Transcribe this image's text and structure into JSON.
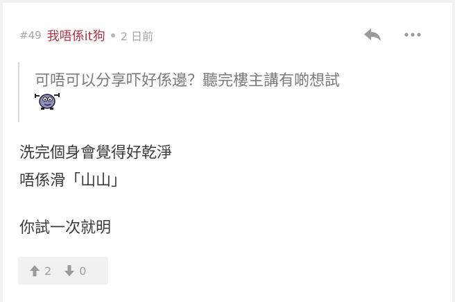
{
  "post": {
    "floor": "#49",
    "author": "我唔係it狗",
    "time": "2 日前",
    "quote": {
      "text": "可唔可以分享吓好係邊？聽完樓主講有啲想試",
      "sticker": "sticker-emoji"
    },
    "body_lines": [
      "洗完個身會覺得好乾淨",
      "唔係滑「山山」",
      "你試一次就明"
    ],
    "votes": {
      "up_count": "2",
      "down_count": "0"
    }
  },
  "icons": {
    "reply": "reply-icon",
    "more": "more-icon",
    "upvote": "arrow-up-icon",
    "downvote": "arrow-down-icon"
  },
  "colors": {
    "author": "#b2333f",
    "muted": "#a6a6a6",
    "text": "#3a3a3a",
    "quote_text": "#7b7b7b",
    "background": "#f1f1f1"
  }
}
